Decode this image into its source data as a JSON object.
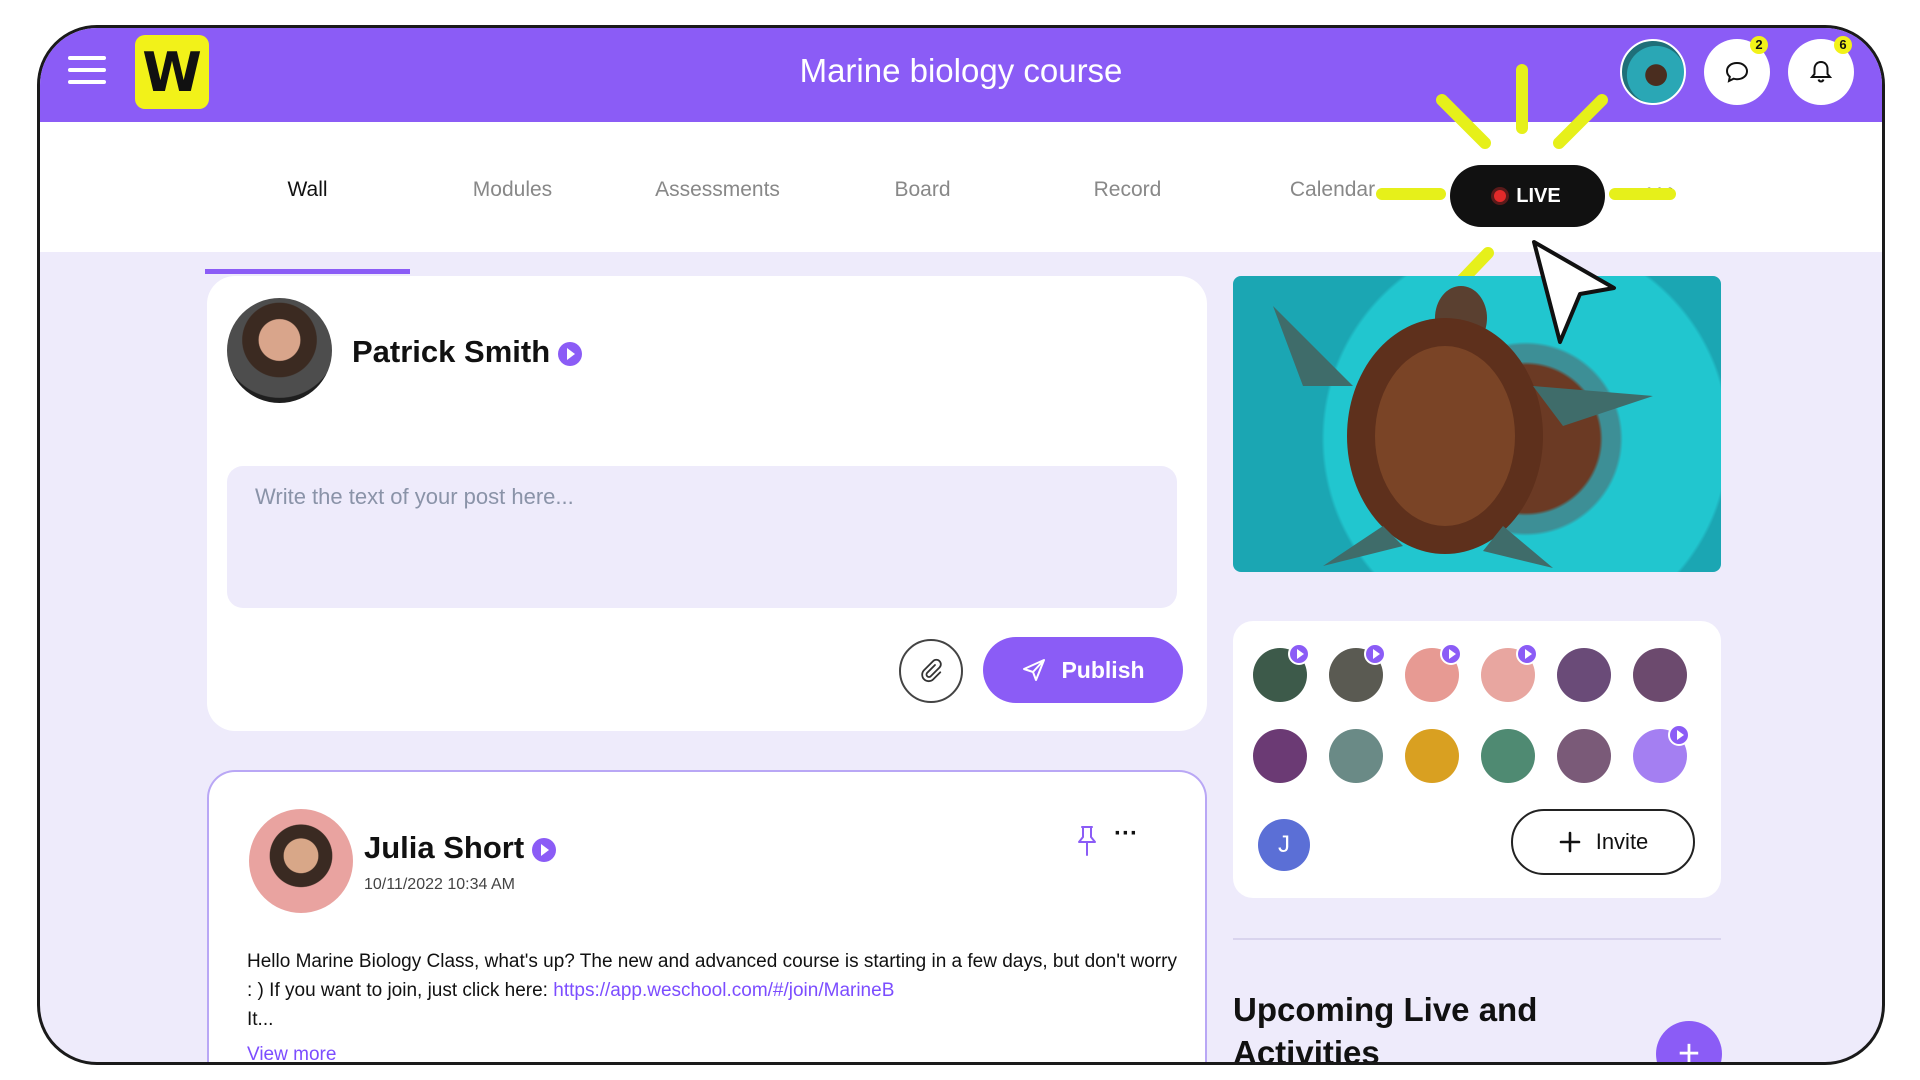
{
  "header": {
    "title": "Marine biology course",
    "logo_text": "W",
    "messages_badge": "2",
    "notifications_badge": "6",
    "brand_color": "#8b5cf6",
    "accent_color": "#f2f219"
  },
  "tabs": [
    {
      "label": "Wall"
    },
    {
      "label": "Modules"
    },
    {
      "label": "Assessments"
    },
    {
      "label": "Board"
    },
    {
      "label": "Record"
    },
    {
      "label": "Calendar"
    }
  ],
  "live_button": {
    "label": "LIVE"
  },
  "composer": {
    "author_name": "Patrick Smith",
    "placeholder": "Write the text of your post here...",
    "publish_label": "Publish"
  },
  "post": {
    "author_name": "Julia Short",
    "date": "10/11/2022 10:34 AM",
    "text_before_link": "Hello Marine Biology Class, what's up? The new and advanced course is starting in a few days, but don't worry : ) If you want to join, just click here: ",
    "link": "https://app.weschool.com/#/join/MarineB",
    "text_after_link": "It...",
    "view_more": "View more"
  },
  "members": {
    "letter_avatar": "J",
    "invite_label": "Invite"
  },
  "upcoming": {
    "title": "Upcoming Live and Activities",
    "add_label": "+"
  },
  "icons": [
    "hamburger-icon",
    "chat-icon",
    "bell-icon",
    "paperclip-icon",
    "send-icon",
    "pin-icon",
    "plus-icon",
    "verified-icon",
    "cursor-icon"
  ]
}
